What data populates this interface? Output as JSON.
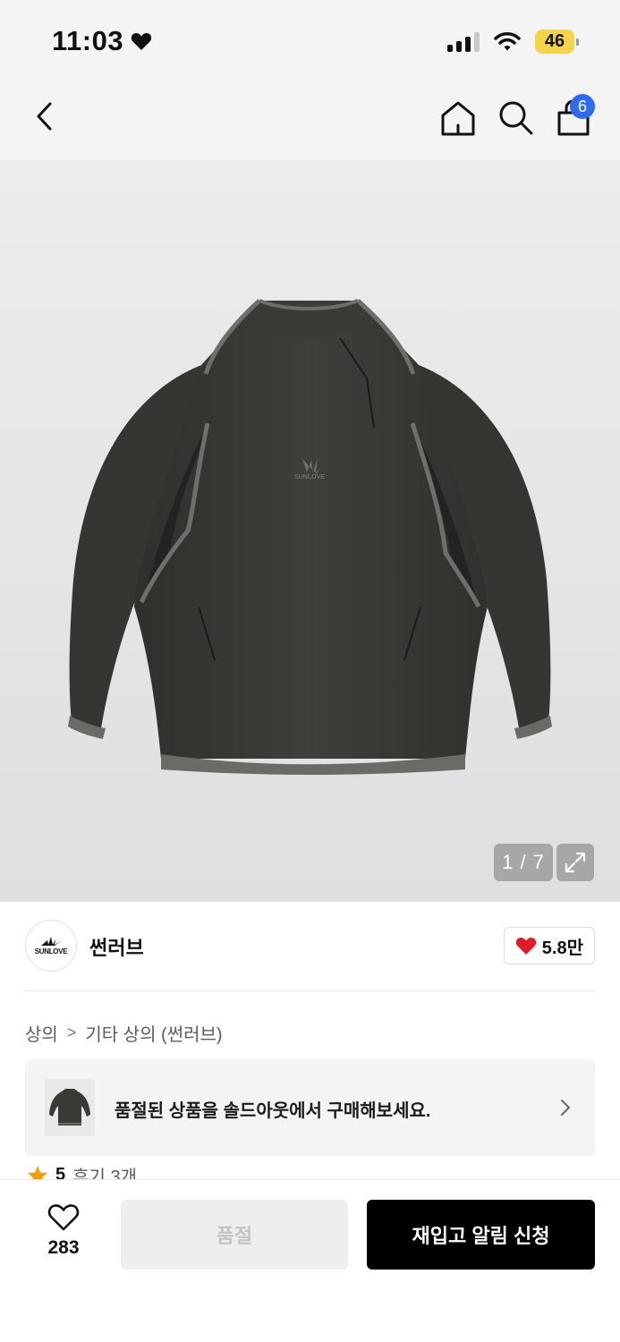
{
  "status_bar": {
    "time": "11:03",
    "battery": "46",
    "battery_color": "#f5d44a"
  },
  "nav": {
    "back_icon": "chevron-left-icon",
    "home_icon": "home-icon",
    "search_icon": "search-icon",
    "cart_icon": "shopping-bag-icon",
    "cart_badge": "6",
    "badge_color": "#2f6bf2"
  },
  "product_image": {
    "counter": "1 / 7",
    "expand_icon": "expand-icon",
    "logo_text": "SUNLOVE"
  },
  "brand": {
    "logo_text": "SUNLOVE",
    "name": "썬러브",
    "likes": "5.8만",
    "heart_color": "#e11d2a"
  },
  "breadcrumb": {
    "items": [
      "상의",
      "기타 상의 (썬러브)"
    ],
    "separator": ">"
  },
  "soldout_banner": {
    "text": "품절된 상품을 솔드아웃에서 구매해보세요."
  },
  "rating": {
    "score": "5",
    "reviews": "후기 3개",
    "star_color": "#f39c12"
  },
  "bottom_bar": {
    "wish_count": "283",
    "soldout_label": "품절",
    "restock_label": "재입고 알림 신청"
  }
}
